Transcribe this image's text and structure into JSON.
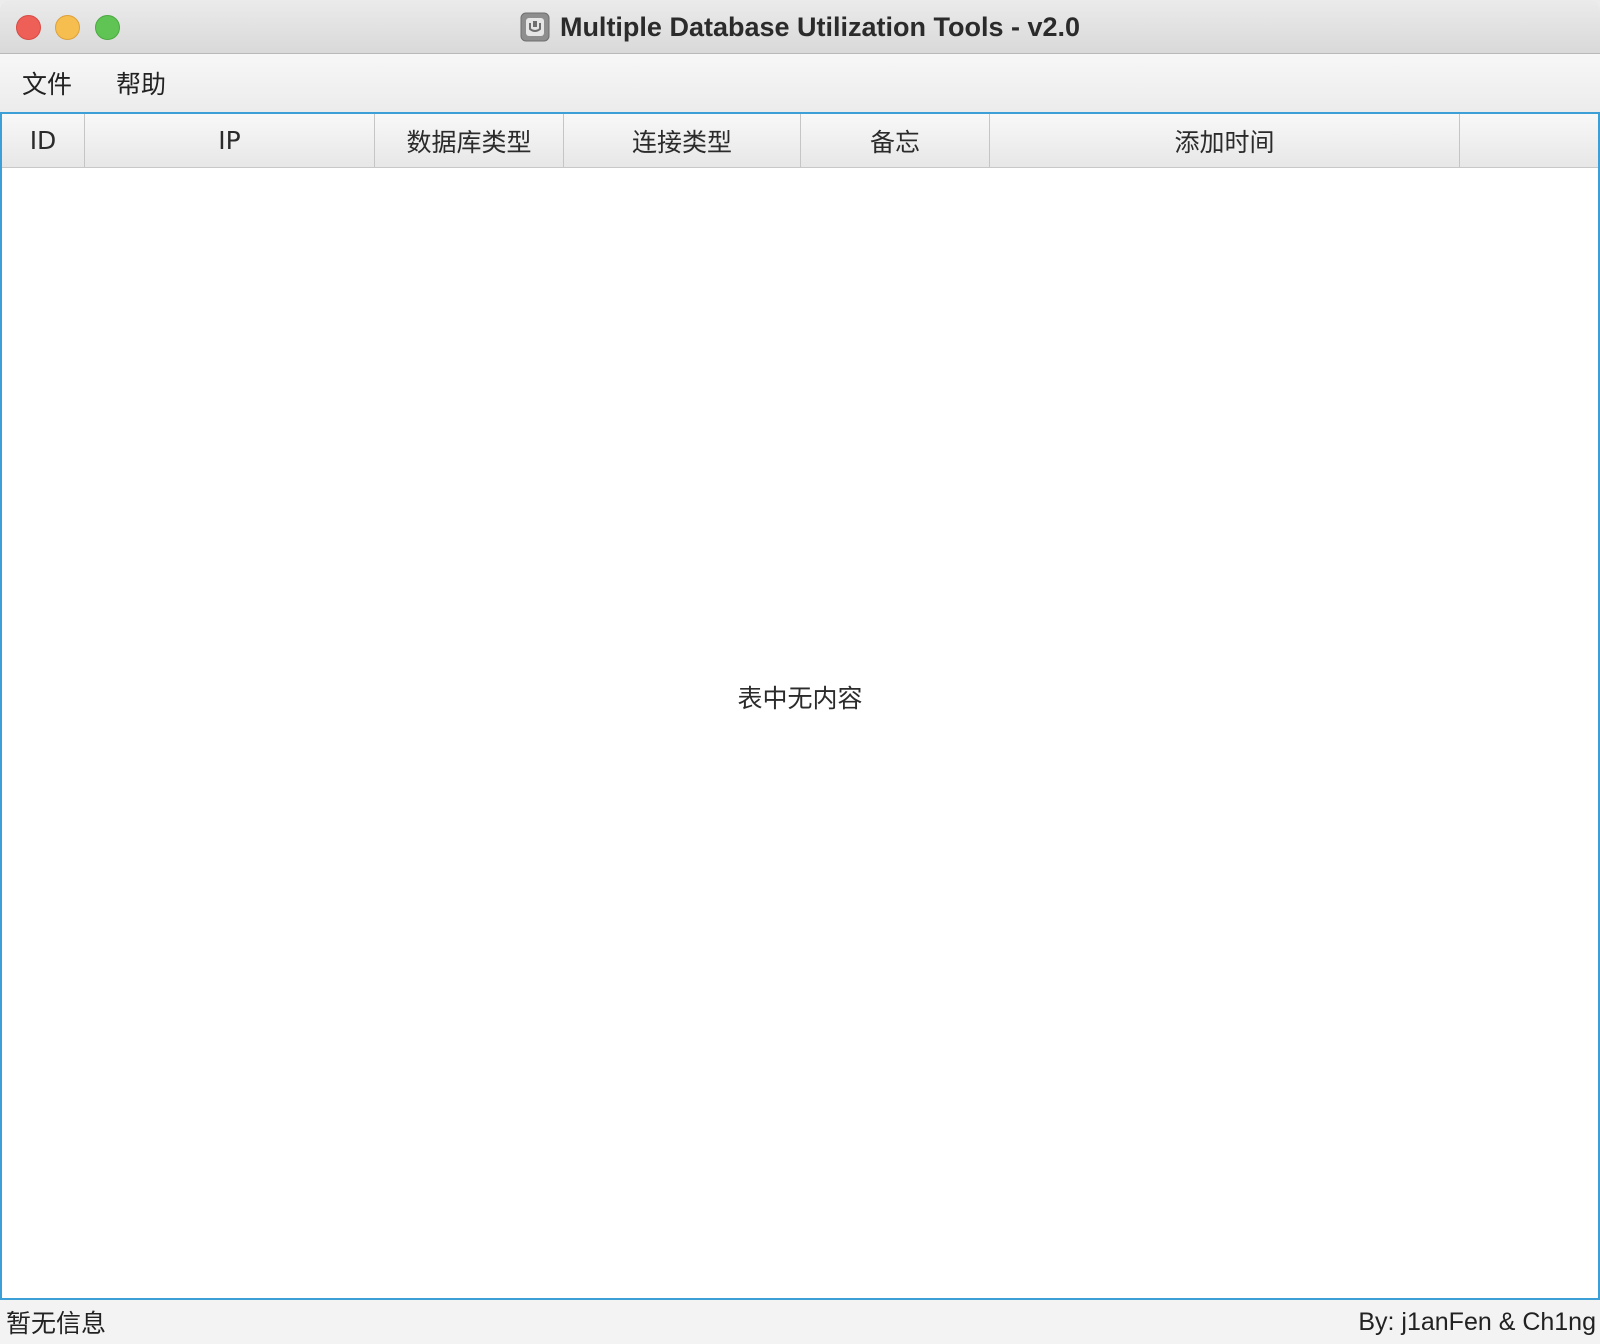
{
  "window": {
    "title": "Multiple Database Utilization Tools - v2.0"
  },
  "menu": {
    "items": [
      {
        "label": "文件"
      },
      {
        "label": "帮助"
      }
    ]
  },
  "table": {
    "columns": [
      "ID",
      "IP",
      "数据库类型",
      "连接类型",
      "备忘",
      "添加时间",
      ""
    ],
    "rows": [],
    "empty_message": "表中无内容"
  },
  "status": {
    "left": "暂无信息",
    "right": "By: j1anFen & Ch1ng"
  },
  "colors": {
    "selection_border": "#3c9fd6",
    "close": "#ee5f58",
    "minimize": "#f6be4f",
    "maximize": "#60c454"
  }
}
